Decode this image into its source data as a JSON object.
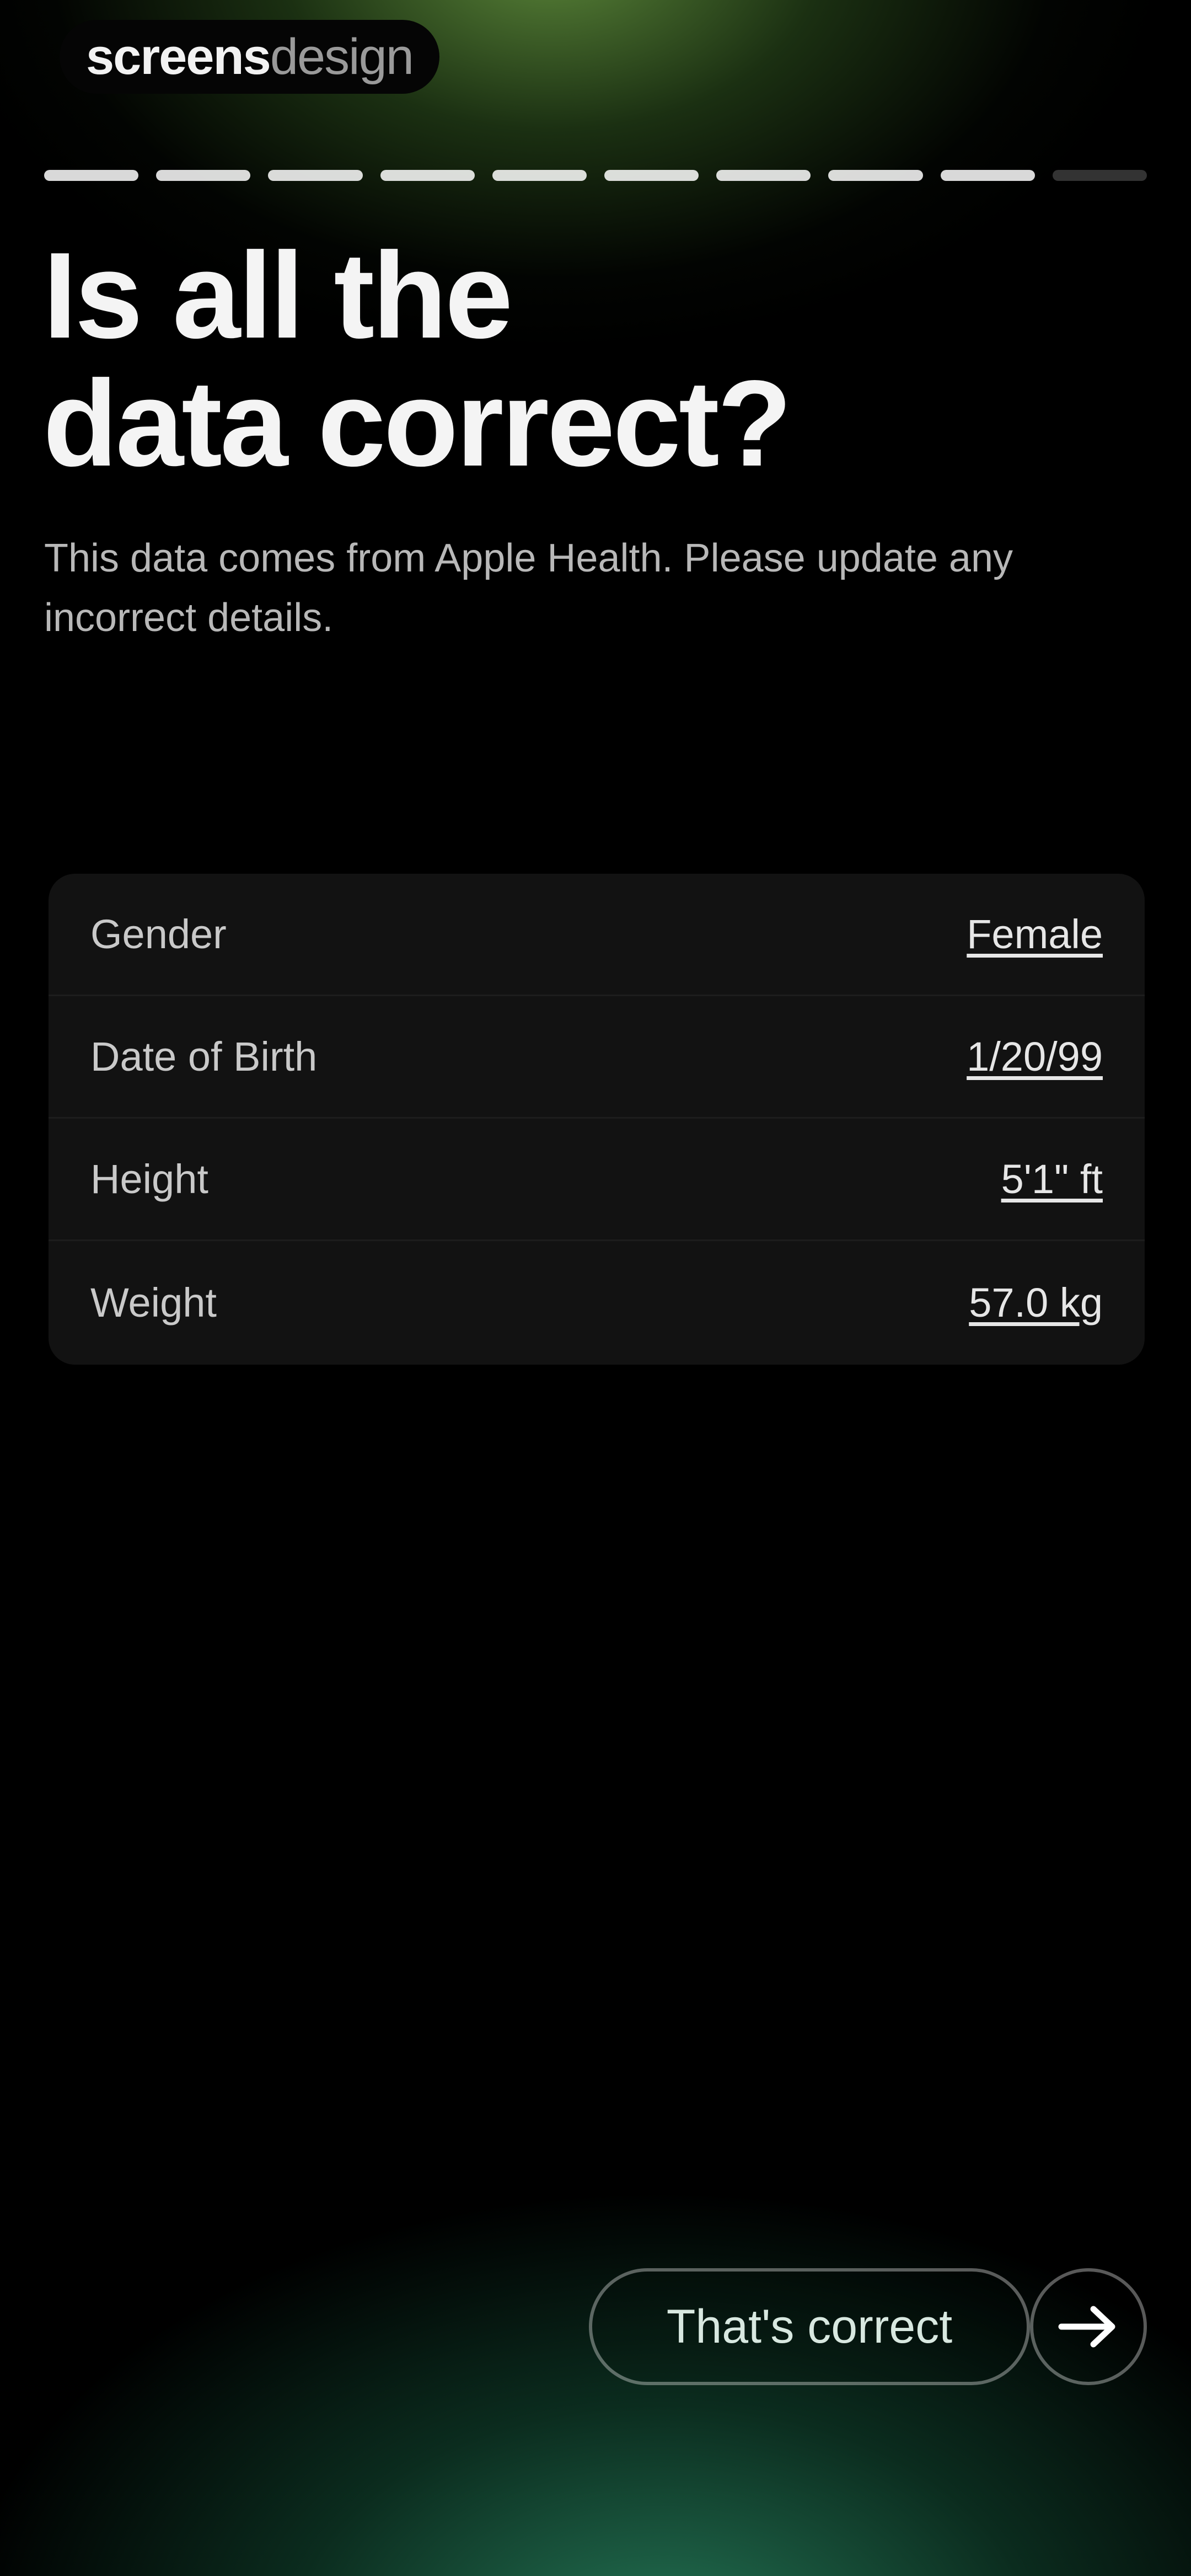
{
  "brand": {
    "part1": "screens",
    "part2": "design"
  },
  "progress": {
    "current_step": 9,
    "total_steps": 10
  },
  "title": {
    "line1": "Is all the",
    "line2": "data correct?"
  },
  "subtitle": "This data comes from Apple Health. Please update any incorrect details.",
  "details": [
    {
      "label": "Gender",
      "value": "Female"
    },
    {
      "label": "Date of Birth",
      "value": "1/20/99"
    },
    {
      "label": "Height",
      "value": "5'1\" ft"
    },
    {
      "label": "Weight",
      "value": "57.0 kg"
    }
  ],
  "cta": {
    "label": "That's correct",
    "icon": "arrow-right-icon"
  },
  "colors": {
    "background": "#000000",
    "top_glow": "#5f8c3c",
    "bottom_glow": "#28825f",
    "card": "#121212"
  }
}
